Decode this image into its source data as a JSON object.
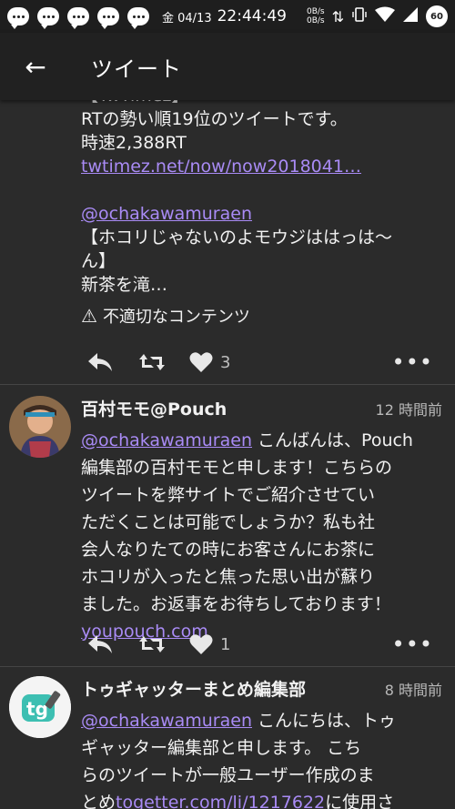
{
  "status_bar": {
    "date": "金 04/13",
    "time": "22:44:49",
    "net_up": "0B/s",
    "net_down": "0B/s",
    "battery": "60",
    "notif_icons": [
      "chat-bubble-icon",
      "chat-bubble-icon",
      "chat-bubble-icon",
      "chat-bubble-icon",
      "chat-bubble-icon"
    ]
  },
  "appbar": {
    "back_icon": "←",
    "title": "ツイート"
  },
  "tweets": [
    {
      "lines": [
        "【TwTimez】",
        "RTの勢い順19位のツイートです。",
        "時速2,388RT"
      ],
      "link": "twtimez.net/now/now2018041…",
      "mention": "@ochakawamuraen",
      "quote_lines": [
        "【ホコリじゃないのよモウジははっは〜",
        "ん】",
        "新茶を滝…"
      ],
      "sensitive_label": "不適切なコンテンツ",
      "likes": "3"
    },
    {
      "author": "百村モモ@Pouch",
      "ago": "12 時間前",
      "mention": "@ochakawamuraen",
      "first_line_rest": " こんばんは、Pouch",
      "lines": [
        "編集部の百村モモと申します！こちらの",
        "ツイートを弊サイトでご紹介させてい",
        "ただくことは可能でしょうか？私も社",
        "会人なりたての時にお客さんにお茶に",
        "ホコリが入ったと焦った思い出が蘇り",
        "ました。お返事をお待ちしております！"
      ],
      "link": "youpouch.com",
      "likes": "1"
    },
    {
      "author": "トゥギャッターまとめ編集部",
      "ago": "8 時間前",
      "mention": "@ochakawamuraen",
      "first_line_rest": " こんにちは、トゥ",
      "lines": [
        "ギャッター編集部と申します。 こち",
        "らのツイートが一般ユーザー作成のま"
      ],
      "last_prefix": "とめ",
      "link": "togetter.com/li/1217622",
      "last_suffix": "に使用さ"
    }
  ]
}
